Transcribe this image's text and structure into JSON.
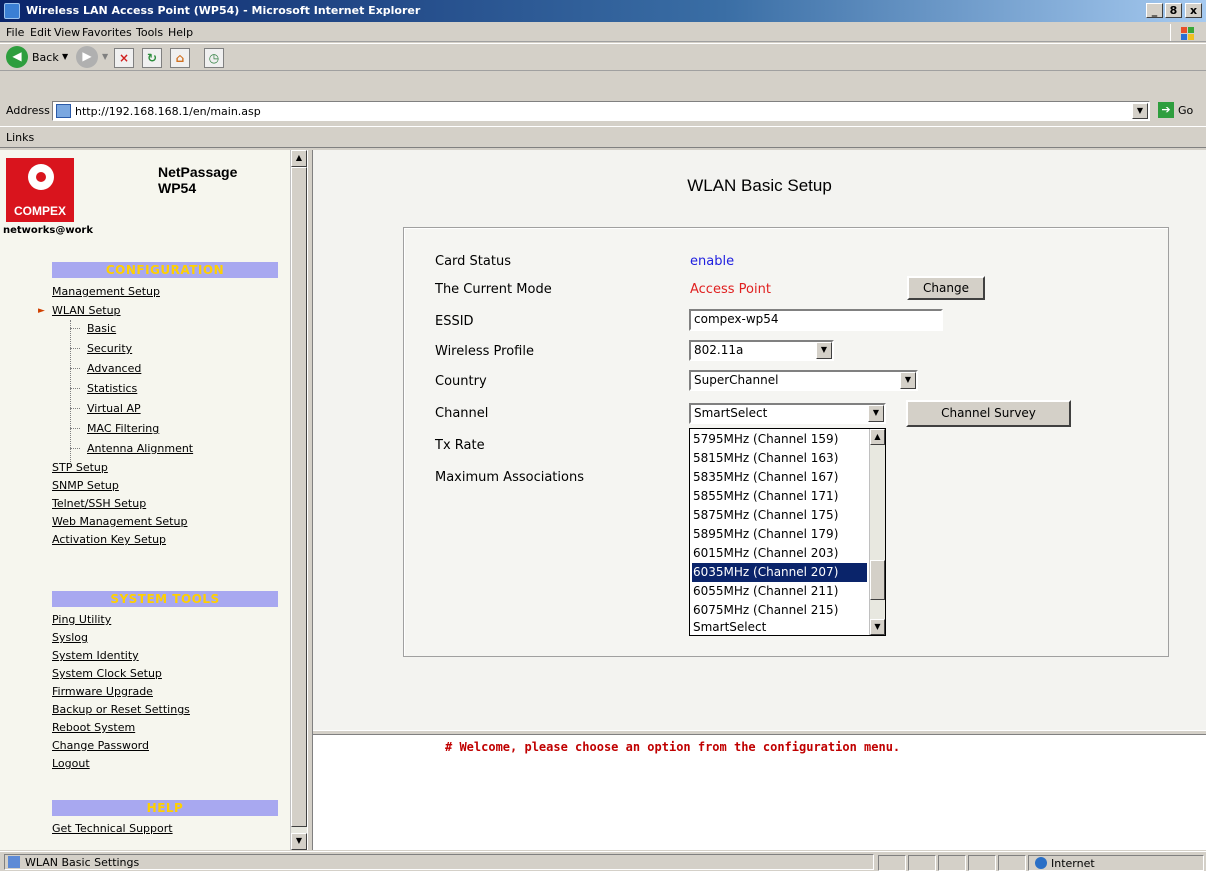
{
  "window": {
    "title": "Wireless LAN Access Point (WP54) - Microsoft Internet Explorer",
    "controls": [
      "_",
      "8",
      "x"
    ]
  },
  "menu": [
    "File",
    "Edit",
    "View",
    "Favorites",
    "Tools",
    "Help"
  ],
  "toolbar": {
    "back_label": "Back"
  },
  "address": {
    "label": "Address",
    "url": "http://192.168.168.1/en/main.asp",
    "go_label": "Go"
  },
  "links_label": "Links",
  "sidebar": {
    "brand": "COMPEX",
    "tagline": "networks@work",
    "product_line1": "NetPassage",
    "product_line2": "WP54",
    "config_header": "CONFIGURATION",
    "config_items": [
      "Management Setup",
      "WLAN Setup"
    ],
    "wlan_subitems": [
      "Basic",
      "Security",
      "Advanced",
      "Statistics",
      "Virtual AP",
      "MAC Filtering",
      "Antenna Alignment"
    ],
    "config_items_2": [
      "STP Setup",
      "SNMP Setup",
      "Telnet/SSH Setup",
      "Web Management Setup",
      "Activation Key Setup"
    ],
    "tools_header": "SYSTEM TOOLS",
    "tools_items": [
      "Ping Utility",
      "Syslog",
      "System Identity",
      "System Clock Setup",
      "Firmware Upgrade",
      "Backup or Reset Settings",
      "Reboot System",
      "Change Password",
      "Logout"
    ],
    "help_header": "HELP",
    "help_items": [
      "Get Technical Support"
    ]
  },
  "main": {
    "title": "WLAN Basic Setup",
    "fields": {
      "card_status_label": "Card Status",
      "card_status_value": "enable",
      "mode_label": "The Current Mode",
      "mode_value": "Access Point",
      "change_button": "Change",
      "essid_label": "ESSID",
      "essid_value": "compex-wp54",
      "profile_label": "Wireless Profile",
      "profile_value": "802.11a",
      "country_label": "Country",
      "country_value": "SuperChannel",
      "channel_label": "Channel",
      "channel_value": "SmartSelect",
      "channel_survey_button": "Channel Survey",
      "txrate_label": "Tx Rate",
      "maxassoc_label": "Maximum Associations"
    },
    "channel_options": [
      "5795MHz (Channel 159)",
      "5815MHz (Channel 163)",
      "5835MHz (Channel 167)",
      "5855MHz (Channel 171)",
      "5875MHz (Channel 175)",
      "5895MHz (Channel 179)",
      "6015MHz (Channel 203)",
      "6035MHz (Channel 207)",
      "6055MHz (Channel 211)",
      "6075MHz (Channel 215)",
      "SmartSelect"
    ],
    "highlighted_option": "6035MHz (Channel 207)"
  },
  "bottom": {
    "message": "# Welcome, please choose an option from the configuration menu."
  },
  "status": {
    "text": "WLAN Basic Settings",
    "zone": "Internet"
  },
  "colors": {
    "accent_nav": "#a8a8f0",
    "header_text": "#ffd000",
    "mode_red": "#e02020",
    "status_blue": "#2020e0"
  }
}
